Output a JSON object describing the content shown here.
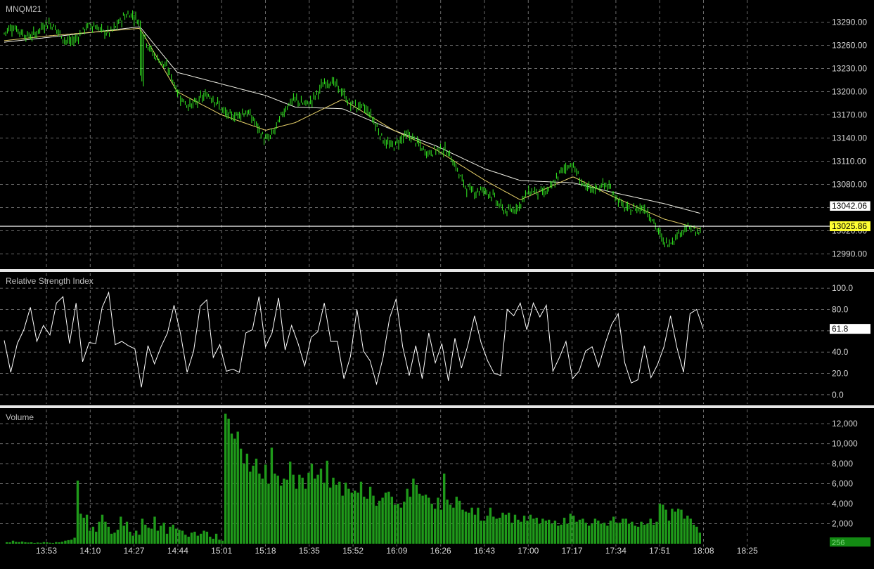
{
  "symbol": "MNQM21",
  "colors": {
    "background": "#000000",
    "grid": "#6b6b6b",
    "candle": "#33ee22",
    "ma_fast": "#e8d26a",
    "ma_slow": "#f0f0e6",
    "rsi_line": "#ffffff",
    "volume": "#1f9a1a",
    "last_price_tag": "#ffff33",
    "ma_tag": "#ffffff",
    "separator": "#e6e6e6",
    "axis_text": "#d8d8d8"
  },
  "x_axis": {
    "ticks": [
      "13:53",
      "14:10",
      "14:27",
      "14:44",
      "15:01",
      "15:18",
      "15:35",
      "15:52",
      "16:09",
      "16:26",
      "16:43",
      "17:00",
      "17:17",
      "17:34",
      "17:51",
      "18:08",
      "18:25"
    ]
  },
  "chart_data": [
    {
      "type": "line",
      "name": "price",
      "title": "MNQM21",
      "y_ticks": [
        "13290.00",
        "13260.00",
        "13230.00",
        "13200.00",
        "13170.00",
        "13140.00",
        "13110.00",
        "13080.00",
        "13050.00",
        "13020.00",
        "12990.00"
      ],
      "ylim": [
        12975,
        13315
      ],
      "grid": true,
      "x": [
        "13:53",
        "14:10",
        "14:27",
        "14:44",
        "15:01",
        "15:18",
        "15:35",
        "15:52",
        "16:09",
        "16:26",
        "16:43",
        "17:00",
        "17:17",
        "17:34",
        "17:51",
        "18:08"
      ],
      "series": [
        {
          "role": "close",
          "values": [
            13268,
            13278,
            13285,
            13205,
            13175,
            13150,
            13190,
            13200,
            13140,
            13120,
            13070,
            13045,
            13105,
            13065,
            13015,
            13025.86
          ]
        },
        {
          "role": "ma_fast",
          "values": [
            13266,
            13272,
            13282,
            13200,
            13170,
            13150,
            13160,
            13190,
            13150,
            13125,
            13085,
            13060,
            13090,
            13065,
            13035,
            13022
          ]
        },
        {
          "role": "ma_slow",
          "values": [
            13264,
            13270,
            13284,
            13225,
            13210,
            13195,
            13180,
            13178,
            13150,
            13130,
            13100,
            13085,
            13082,
            13070,
            13055,
            13042.06
          ]
        }
      ],
      "price_tags": {
        "last": "13025.86",
        "ma": "13042.06"
      }
    },
    {
      "type": "line",
      "title": "Relative Strength Index",
      "y_ticks": [
        "100.0",
        "80.0",
        "60.0",
        "40.0",
        "20.0",
        "0.0"
      ],
      "ylim": [
        -8,
        112
      ],
      "grid": true,
      "value_tag": "61.8",
      "values": [
        51,
        21,
        48,
        61,
        82,
        50,
        65,
        56,
        86,
        92,
        48,
        86,
        31,
        49,
        48,
        82,
        96,
        47,
        50,
        46,
        43,
        7,
        46,
        29,
        45,
        58,
        84,
        57,
        21,
        41,
        83,
        89,
        35,
        47,
        22,
        24,
        21,
        58,
        61,
        92,
        45,
        58,
        91,
        42,
        65,
        48,
        27,
        54,
        59,
        86,
        50,
        50,
        15,
        36,
        80,
        41,
        32,
        10,
        35,
        72,
        90,
        45,
        18,
        46,
        15,
        58,
        30,
        48,
        13,
        53,
        25,
        47,
        74,
        49,
        32,
        20,
        18,
        80,
        74,
        86,
        61,
        86,
        73,
        84,
        22,
        35,
        50,
        15,
        22,
        41,
        45,
        26,
        48,
        66,
        76,
        30,
        11,
        14,
        46,
        16,
        28,
        45,
        74,
        44,
        21,
        76,
        80,
        62
      ]
    },
    {
      "type": "bar",
      "title": "Volume",
      "y_ticks": [
        "12,000",
        "10,000",
        "8,000",
        "6,000",
        "4,000",
        "2,000"
      ],
      "ylim": [
        0,
        13200
      ],
      "grid": true,
      "value_tag": "256",
      "values": [
        150,
        130,
        300,
        180,
        160,
        220,
        150,
        120,
        140,
        80,
        120,
        90,
        160,
        140,
        100,
        80,
        160,
        140,
        200,
        300,
        360,
        400,
        600,
        6300,
        3000,
        2600,
        2900,
        1300,
        1700,
        1200,
        2200,
        2900,
        2200,
        1700,
        1000,
        1100,
        1400,
        2700,
        1800,
        2200,
        1200,
        800,
        1300,
        900,
        2500,
        1900,
        1600,
        1500,
        2700,
        1300,
        1800,
        2100,
        1000,
        1700,
        1900,
        1500,
        1400,
        1300,
        900,
        700,
        1100,
        1200,
        800,
        1000,
        1300,
        1200,
        700,
        500,
        1000,
        400,
        300,
        13000,
        12500,
        11000,
        10500,
        11200,
        9500,
        8000,
        9000,
        7200,
        7800,
        8500,
        7000,
        6500,
        7900,
        6000,
        9600,
        7000,
        6800,
        5800,
        6500,
        6400,
        8200,
        6900,
        5500,
        6900,
        6600,
        5500,
        7100,
        8000,
        6500,
        6900,
        7500,
        6100,
        8300,
        5600,
        6600,
        5900,
        6200,
        4800,
        6100,
        5500,
        5100,
        5300,
        5100,
        6200,
        4700,
        4500,
        5700,
        4800,
        3800,
        4300,
        4600,
        5100,
        5200,
        4700,
        3900,
        4000,
        3600,
        4200,
        5500,
        4700,
        6500,
        5900,
        5000,
        4800,
        4900,
        4600,
        4000,
        3500,
        4600,
        3400,
        7000,
        4400,
        3900,
        3600,
        4700,
        4300,
        3400,
        3200,
        3100,
        3600,
        2900,
        3600,
        2300,
        2300,
        2800,
        3600,
        2700,
        2500,
        2600,
        3100,
        2900,
        3100,
        2100,
        2900,
        2400,
        2200,
        2800,
        2300,
        2900,
        2500,
        2600,
        2000,
        2500,
        2300,
        2400,
        2000,
        2300,
        1800,
        1900,
        2600,
        2000,
        3000,
        2800,
        2200,
        2400,
        2500,
        2100,
        1800,
        2000,
        2500,
        2300,
        2000,
        2100,
        1800,
        2300,
        2700,
        2100,
        2100,
        2500,
        2500,
        2000,
        2200,
        1800,
        1700,
        2200,
        1900,
        2000,
        2500,
        1900,
        2200,
        4000,
        3900,
        3400,
        2300,
        3500,
        3200,
        3500,
        3400,
        2500,
        2800,
        2500,
        1900,
        1700,
        1100
      ]
    }
  ]
}
